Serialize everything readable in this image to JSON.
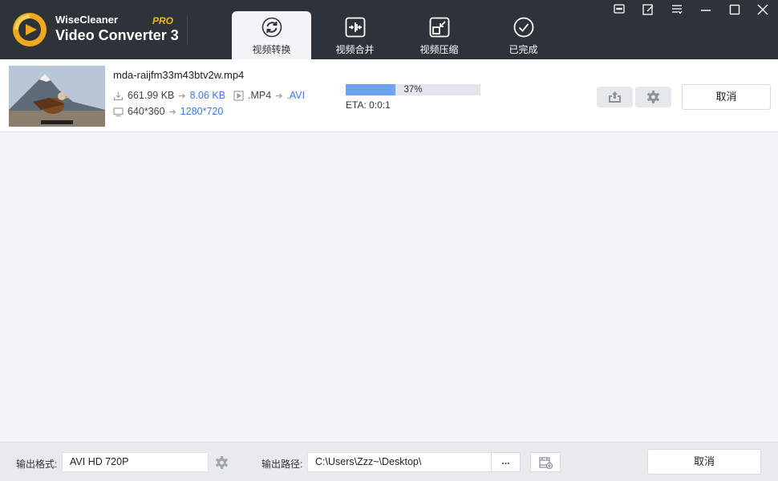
{
  "app": {
    "brand_top": "WiseCleaner",
    "brand_main": "Video Converter 3",
    "brand_badge": "PRO",
    "accent": "#f0b41c"
  },
  "tabs": [
    {
      "label": "视频转换",
      "icon": "refresh-icon",
      "active": true
    },
    {
      "label": "视频合并",
      "icon": "merge-icon",
      "active": false
    },
    {
      "label": "视频压缩",
      "icon": "compress-icon",
      "active": false
    },
    {
      "label": "已完成",
      "icon": "check-circle-icon",
      "active": false
    }
  ],
  "window_controls": [
    "chat-icon",
    "edit-icon",
    "menu-icon",
    "minimize-icon",
    "maximize-icon",
    "close-icon"
  ],
  "file": {
    "name": "mda-raijfm33m43btv2w.mp4",
    "size_from": "661.99 KB",
    "size_to": "8.06 KB",
    "format_from": ".MP4",
    "format_to": ".AVI",
    "res_from": "640*360",
    "res_to": "1280*720",
    "progress": 37,
    "progress_label": "37%",
    "eta": "ETA: 0:0:1",
    "cancel_label": "取消"
  },
  "bottom": {
    "format_label": "输出格式:",
    "format_value": "AVI   HD 720P",
    "path_label": "输出路径:",
    "path_value": "C:\\Users\\Zzz~\\Desktop\\",
    "browse_label": "...",
    "cancel_label": "取消"
  },
  "colors": {
    "titlebar": "#2d3339",
    "progress_fill": "#6fa3f0",
    "link_blue": "#3a7bd5"
  }
}
